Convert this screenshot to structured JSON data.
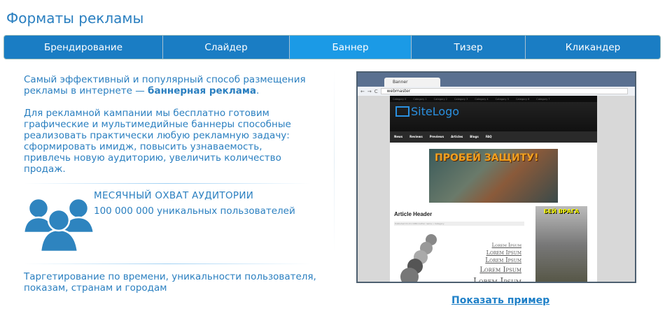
{
  "page_title": "Форматы рекламы",
  "tabs": [
    {
      "label": "Брендирование"
    },
    {
      "label": "Слайдер"
    },
    {
      "label": "Баннер",
      "active": true
    },
    {
      "label": "Тизер"
    },
    {
      "label": "Кликандер"
    }
  ],
  "intro": {
    "text": "Самый эффективный и популярный способ размещения рекламы в интернете — ",
    "bold": "баннерная реклама",
    "end": "."
  },
  "desc": "Для рекламной кампании мы бесплатно готовим графические и мультимедийные баннеры способные реализовать практически любую рекламную задачу: сформировать имидж, повысить узнаваемость, привлечь новую аудиторию, увеличить количество продаж.",
  "reach": {
    "heading": "МЕСЯЧНЫЙ ОХВАТ АУДИТОРИИ",
    "value": "100 000 000 уникальных пользователей",
    "icon": "users-icon"
  },
  "targeting": "Таргетирование по времени, уникальности пользователя, показам, странам и городам",
  "example": {
    "browser_tab": "Banner",
    "address": "webmaster",
    "categories": [
      "Category 0",
      "Category 1",
      "Category 2",
      "Category 3",
      "Category 4",
      "Category 5",
      "Category 6",
      "Category 7"
    ],
    "logo": "SiteLogo",
    "nav": [
      "News",
      "Reviews",
      "Previews",
      "Articles",
      "Blogs",
      "FAQ"
    ],
    "banner_text": "ПРОБЕЙ ЗАЩИТУ!",
    "article_header": "Article Header",
    "meta": "Published 01.01.1980 Author name » Category",
    "lorem": [
      "Lorem Ipsum",
      "Lorem Ipsum",
      "Lorem Ipsum",
      "Lorem Ipsum",
      "Lorem Ipsum"
    ],
    "side_banner_text": "БЕЙ ВРАГА"
  },
  "show_example": "Показать пример",
  "colors": {
    "accent": "#2a7fc0",
    "tab_bg": "#1a7dc4",
    "tab_active": "#1b9ae6"
  }
}
